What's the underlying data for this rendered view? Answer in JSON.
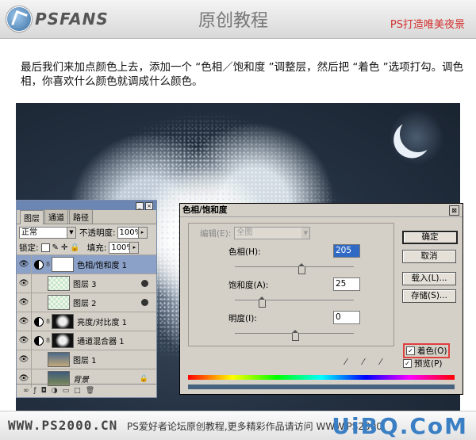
{
  "banner": {
    "logo_text": "PSFANS",
    "title": "原创教程",
    "slogan": "PS打造唯美夜景"
  },
  "intro_text": "最后我们来加点颜色上去，添加一个 “色相／饱和度 ”调整层，然后把 “着色 ”选项打勾。调色相，你喜欢什么颜色就调成什么颜色。",
  "layers_panel": {
    "tabs": [
      "图层",
      "通道",
      "路径"
    ],
    "blend_mode": "正常",
    "opacity_label": "不透明度:",
    "opacity_value": "100%",
    "lock_label": "锁定:",
    "fill_label": "填充:",
    "fill_value": "100%",
    "layers": [
      {
        "name": "色相/饱和度 1",
        "selected": true
      },
      {
        "name": "图层 3"
      },
      {
        "name": "图层 2"
      },
      {
        "name": "亮度/对比度 1"
      },
      {
        "name": "通道混合器 1"
      },
      {
        "name": "图层 1"
      },
      {
        "name": "背景"
      }
    ]
  },
  "dialog": {
    "title": "色相/饱和度",
    "edit_label": "编辑(E):",
    "edit_value": "全图",
    "hue_label": "色相(H):",
    "hue_value": "205",
    "sat_label": "饱和度(A):",
    "sat_value": "25",
    "light_label": "明度(I):",
    "light_value": "0",
    "ok": "确定",
    "cancel": "取消",
    "load": "载入(L)...",
    "save": "存储(S)...",
    "colorize": "着色(O)",
    "preview": "预览(P)"
  },
  "footer": {
    "site": "WWW.PS2000.CN",
    "text": "PS爱好者论坛原创教程,更多精彩作品请访问 WWW.PS2000.CN",
    "watermark": "UiBQ.CoM"
  },
  "colors": {
    "accent_red": "#d2312f",
    "selection_blue": "#8ca1c8",
    "night_sky": "#233040"
  }
}
